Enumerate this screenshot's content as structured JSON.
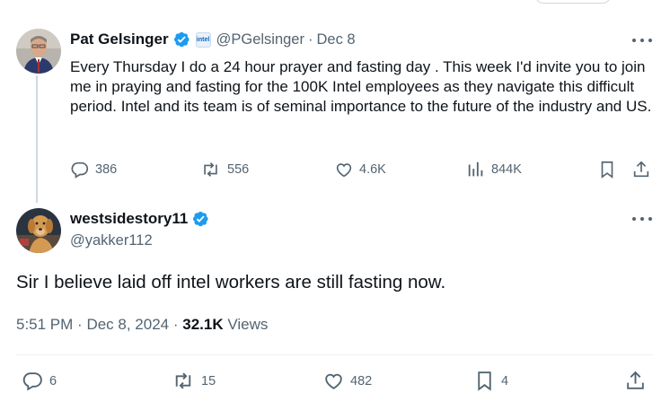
{
  "original_tweet": {
    "author": {
      "name": "Pat Gelsinger",
      "handle": "@PGelsinger",
      "verified": true,
      "affiliation_badge": "intel"
    },
    "date": "Dec 8",
    "text": "Every Thursday I do a 24 hour prayer and fasting day . This week I'd invite you to join me in praying and fasting for the 100K Intel employees as they navigate this difficult period. Intel and its team is of seminal importance to the future of the industry and US.",
    "stats": {
      "replies": "386",
      "reposts": "556",
      "likes": "4.6K",
      "views": "844K"
    }
  },
  "reply_tweet": {
    "author": {
      "name": "westsidestory11",
      "handle": "@yakker112",
      "verified": true
    },
    "text": "Sir I believe laid off intel workers are still fasting now.",
    "time": "5:51 PM",
    "date": "Dec 8, 2024",
    "views_count": "32.1K",
    "views_label": "Views",
    "stats": {
      "replies": "6",
      "reposts": "15",
      "likes": "482",
      "bookmarks": "4"
    }
  },
  "colors": {
    "text_primary": "#0f1419",
    "text_secondary": "#536471",
    "verified_blue": "#1d9bf0",
    "border": "#cfd9de"
  },
  "icons": [
    "reply-icon",
    "repost-icon",
    "like-icon",
    "views-icon",
    "bookmark-icon",
    "share-icon",
    "more-icon",
    "verified-icon"
  ]
}
